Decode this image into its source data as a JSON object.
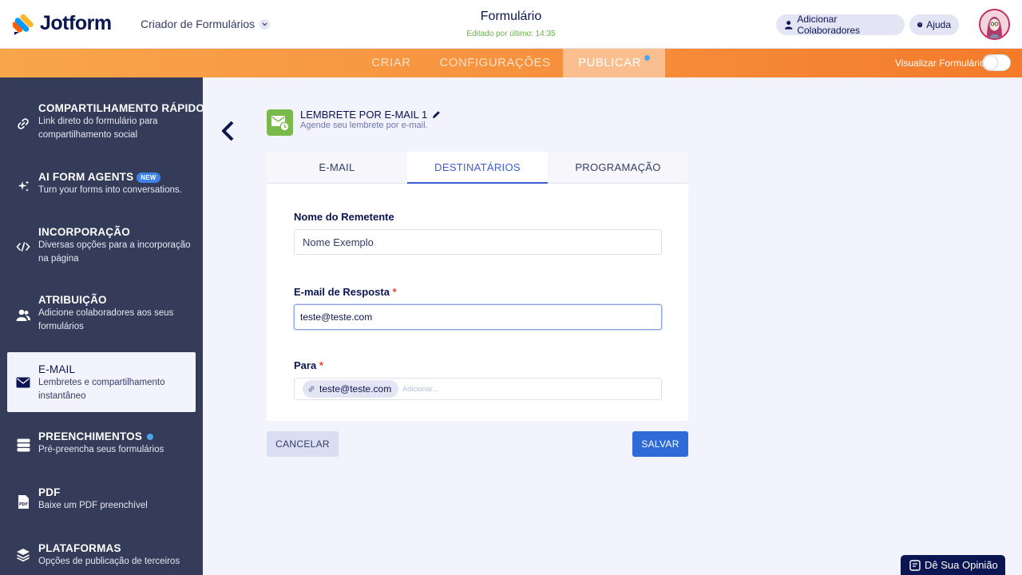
{
  "header": {
    "logo_text": "Jotform",
    "builder_label": "Criador de Formulários",
    "form_title": "Formulário",
    "last_edited": "Editado por último: 14:35",
    "add_collaborators": "Adicionar Colaboradores",
    "help": "Ajuda"
  },
  "nav": {
    "tabs": [
      "CRIAR",
      "CONFIGURAÇÕES",
      "PUBLICAR"
    ],
    "preview_label": "Visualizar Formulário"
  },
  "sidebar": {
    "items": [
      {
        "title": "COMPARTILHAMENTO RÁPIDO",
        "desc": "Link direto do formulário para compartilhamento social"
      },
      {
        "title": "AI FORM AGENTS",
        "badge": "NEW",
        "desc": "Turn your forms into conversations."
      },
      {
        "title": "INCORPORAÇÃO",
        "desc": "Diversas opções para a incorporação na página"
      },
      {
        "title": "ATRIBUIÇÃO",
        "desc": "Adicione colaboradores aos seus formulários"
      },
      {
        "title": "E-MAIL",
        "desc": "Lembretes e compartilhamento instantâneo"
      },
      {
        "title": "PREENCHIMENTOS",
        "desc": "Pré-preencha seus formulários"
      },
      {
        "title": "PDF",
        "desc": "Baixe um PDF preenchível"
      },
      {
        "title": "PLATAFORMAS",
        "desc": "Opções de publicação de terceiros"
      }
    ]
  },
  "reminder": {
    "title": "LEMBRETE POR E-MAIL 1",
    "subtitle": "Agende seu lembrete por e-mail."
  },
  "tabs": [
    "E-MAIL",
    "DESTINATÁRIOS",
    "PROGRAMAÇÃO"
  ],
  "form": {
    "sender_label": "Nome do Remetente",
    "sender_value": "Nome Exemplo",
    "reply_label": "E-mail de Resposta",
    "reply_value": "teste@teste.com",
    "to_label": "Para",
    "to_tag": "teste@teste.com",
    "to_placeholder": "Adicionar..."
  },
  "buttons": {
    "cancel": "CANCELAR",
    "save": "SALVAR"
  },
  "feedback": "Dê Sua Opinião",
  "colors": {
    "accent_orange": "#f7923f",
    "sidebar_bg": "#343c59",
    "primary_blue": "#2e6ad8",
    "reminder_green": "#78bb4b"
  }
}
